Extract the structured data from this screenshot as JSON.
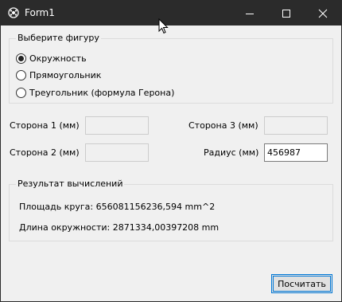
{
  "window": {
    "title": "Form1"
  },
  "shape_group": {
    "title": "Выберите фигуру",
    "options": [
      {
        "label": "Окружность",
        "checked": true
      },
      {
        "label": "Прямоугольник",
        "checked": false
      },
      {
        "label": "Треугольник (формула Герона)",
        "checked": false
      }
    ]
  },
  "inputs": {
    "side1_label": "Сторона 1 (мм)",
    "side1_value": "",
    "side2_label": "Сторона 2 (мм)",
    "side2_value": "",
    "side3_label": "Сторона 3 (мм)",
    "side3_value": "",
    "radius_label": "Радиус (мм)",
    "radius_value": "456987"
  },
  "result_group": {
    "title": "Результат вычислений",
    "area_text": "Площадь круга: 656081156236,594 mm^2",
    "length_text": "Длина окружности: 2871334,00397208 mm"
  },
  "actions": {
    "calculate_label": "Посчитать"
  }
}
